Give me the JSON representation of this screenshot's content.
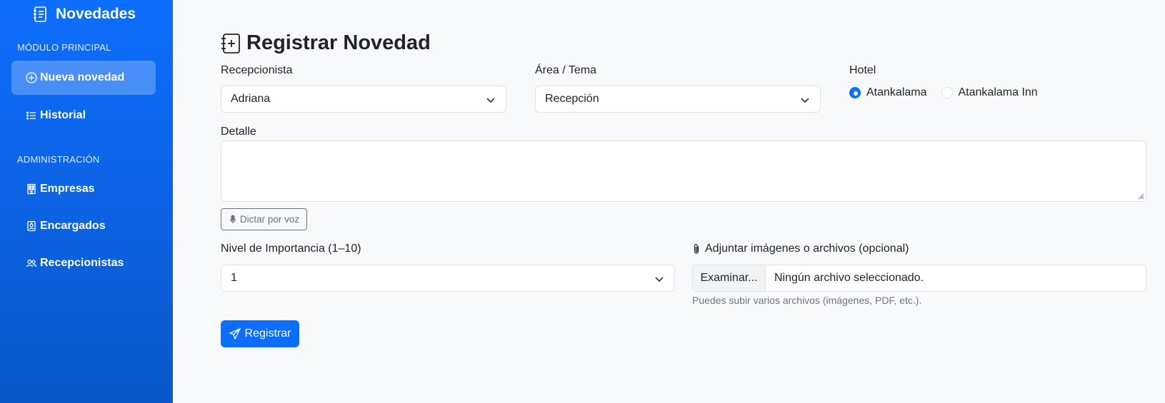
{
  "sidebar": {
    "brand": "Novedades",
    "sections": [
      {
        "label": "MÓDULO PRINCIPAL",
        "items": [
          {
            "label": "Nueva novedad",
            "icon": "plus-circle-icon",
            "active": true
          },
          {
            "label": "Historial",
            "icon": "list-icon",
            "active": false
          }
        ]
      },
      {
        "label": "ADMINISTRACIÓN",
        "items": [
          {
            "label": "Empresas",
            "icon": "building-icon",
            "active": false
          },
          {
            "label": "Encargados",
            "icon": "badge-icon",
            "active": false
          },
          {
            "label": "Recepcionistas",
            "icon": "people-icon",
            "active": false
          }
        ]
      }
    ]
  },
  "form": {
    "title": "Registrar Novedad",
    "recepcionista": {
      "label": "Recepcionista",
      "value": "Adriana"
    },
    "area": {
      "label": "Área / Tema",
      "value": "Recepción"
    },
    "hotel": {
      "label": "Hotel",
      "options": [
        {
          "label": "Atankalama",
          "checked": true
        },
        {
          "label": "Atankalama Inn",
          "checked": false
        }
      ]
    },
    "detalle": {
      "label": "Detalle",
      "value": ""
    },
    "voice_button": "Dictar por voz",
    "importancia": {
      "label": "Nivel de Importancia (1–10)",
      "value": "1"
    },
    "adjuntar": {
      "label": "Adjuntar imágenes o archivos (opcional)",
      "browse": "Examinar...",
      "no_file": "Ningún archivo seleccionado.",
      "help": "Puedes subir varios archivos (imágenes, PDF, etc.)."
    },
    "submit": "Registrar"
  },
  "colors": {
    "primary": "#0d6efd",
    "sidebar_bottom": "#0a58ca",
    "background": "#f8f9fa",
    "muted": "#6c757d"
  }
}
